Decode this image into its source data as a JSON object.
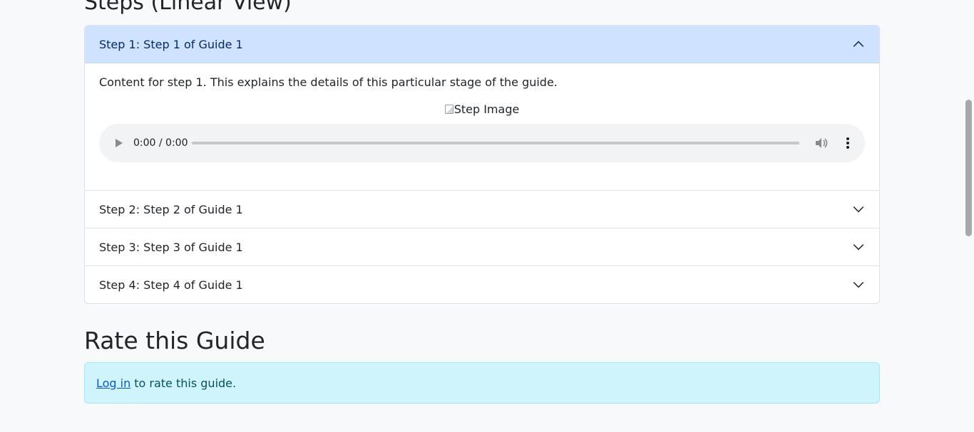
{
  "steps_section": {
    "title": "Steps (Linear View)",
    "steps": [
      {
        "label": "Step 1: Step 1 of Guide 1",
        "expanded": true,
        "content": "Content for step 1. This explains the details of this particular stage of the guide.",
        "image_alt": "Step Image",
        "audio_time": "0:00 / 0:00"
      },
      {
        "label": "Step 2: Step 2 of Guide 1",
        "expanded": false
      },
      {
        "label": "Step 3: Step 3 of Guide 1",
        "expanded": false
      },
      {
        "label": "Step 4: Step 4 of Guide 1",
        "expanded": false
      }
    ]
  },
  "rating": {
    "title": "Rate this Guide",
    "login_link": "Log in",
    "message": "to rate this guide."
  },
  "colors": {
    "active_header_bg": "#cfe2ff",
    "info_alert_bg": "#cff4fc",
    "link": "#0a58ca"
  }
}
